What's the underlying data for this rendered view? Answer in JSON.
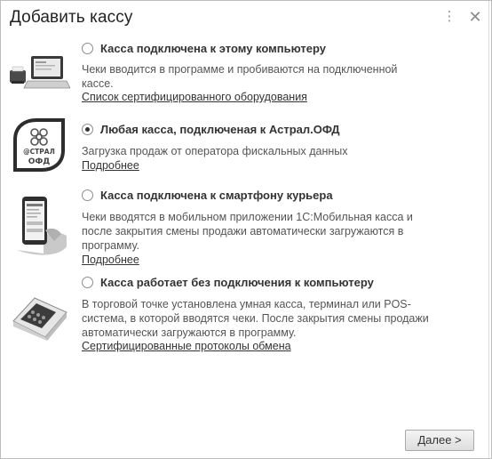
{
  "window": {
    "title": "Добавить кассу",
    "more_icon": "vertical-dots-icon",
    "close_icon": "close-icon"
  },
  "options": [
    {
      "title": "Касса подключена к этому компьютеру",
      "description": "Чеки вводится в программе и пробиваются на подключенной кассе.",
      "link": "Список сертифицированного оборудования",
      "selected": false,
      "icon": "laptop-with-receipt-printer-icon"
    },
    {
      "title": "Любая касса, подключеная к Астрал.ОФД",
      "description": "Загрузка продаж от оператора фискальных данных",
      "link": "Подробнее",
      "selected": true,
      "icon": "astral-ofd-logo-icon",
      "logo_text_top": "@СТРАЛ",
      "logo_text_bottom": "ОФД"
    },
    {
      "title": "Касса подключена к смартфону курьера",
      "description": "Чеки вводятся в мобильном приложении 1С:Мобильная касса и после закрытия смены продажи автоматически загружаются в программу.",
      "link": "Подробнее",
      "selected": false,
      "icon": "smartphone-in-hand-icon"
    },
    {
      "title": "Касса работает без подключения к компьютеру",
      "description": "В торговой точке установлена умная касса, терминал или POS-система, в которой вводятся чеки. После закрытия смены продажи автоматически загружаются в программу.",
      "link": "Сертифицированные протоколы обмена",
      "selected": false,
      "icon": "smart-cash-terminal-icon"
    }
  ],
  "footer": {
    "next_label": "Далее >"
  }
}
